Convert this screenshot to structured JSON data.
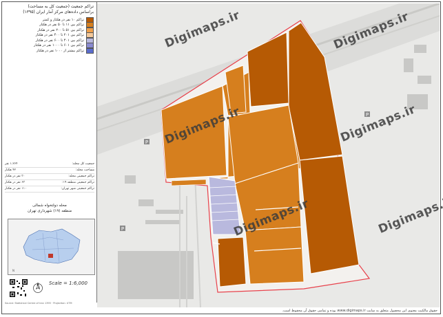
{
  "panel": {
    "title_line1": "تراکم جمعیت (جمعیت کل به مساحت)",
    "title_line2": "براساس داده‌های مرکز آمار ایران (۱۳۹۵)",
    "legend": [
      {
        "label": "تراکم ۱۰ نفر در هکتار و کمتر",
        "color": "#b65a04"
      },
      {
        "label": "تراکم بین ۱۱ تا ۵۰ نفر در هکتار",
        "color": "#d67f1e"
      },
      {
        "label": "تراکم بین ۵۱ تا ۲۰۰ نفر در هکتار",
        "color": "#f0a04b"
      },
      {
        "label": "تراکم بین ۲۰۱ تا ۴۰۰ نفر در هکتار",
        "color": "#f5c99a"
      },
      {
        "label": "تراکم بین ۴۰۱ تا ۶۰۰ نفر در هکتار",
        "color": "#b9b9de"
      },
      {
        "label": "تراکم بین ۶۰۱ تا ۱۰۰۰ نفر در هکتار",
        "color": "#8a8ad0"
      },
      {
        "label": "تراکم بیشتر از ۱۰۰۰ نفر در هکتار",
        "color": "#5a6ccc"
      }
    ],
    "stats": [
      {
        "label": "جمعیت کل محله:",
        "value": "۱،۲۶۴ نفر"
      },
      {
        "label": "مساحت محله:",
        "value": "۴۲ هکتار"
      },
      {
        "label": "تراکم جمعیتی محله:",
        "value": "۳۰ نفر در هکتار"
      },
      {
        "label": "تراکم جمعیتی منطقه ۱۹:",
        "value": "۶۳ نفر در هکتار"
      },
      {
        "label": "تراکم جمعیتی شهر تهران:",
        "value": "۱۱۰ نفر در هکتار"
      }
    ],
    "area_line1": "محله دولتخواه شمالی",
    "area_line2": "منطقه (۱۹) شهرداری تهران",
    "scale": "Scale = 1:6,000",
    "north": "N",
    "panel_footer": "Source: Statistical Centre of Iran 1395 · Projection: UTM"
  },
  "map": {
    "watermark": "Digimaps.ir",
    "parking_marker": "P",
    "colors": {
      "dark": "#b65a04",
      "medium": "#d67f1e",
      "lilac": "#b9b9de",
      "boundary": "#e8404a",
      "base": "#e8e8e6"
    }
  },
  "footer": {
    "text": "حقوق مالکیت معنوی این محصول متعلق به سایت www.digimaps.ir بوده و تمامی حقوق آن محفوظ است."
  }
}
